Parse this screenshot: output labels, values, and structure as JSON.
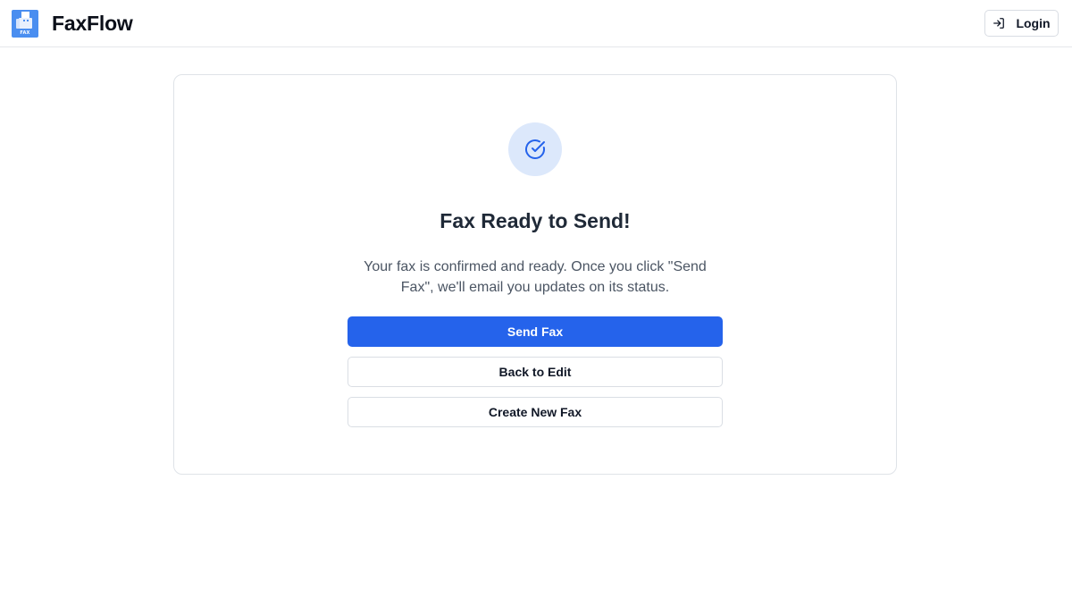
{
  "header": {
    "logo_text": "FAX",
    "app_name": "FaxFlow",
    "login_label": "Login",
    "login_icon": "login-arrow-icon"
  },
  "confirmation": {
    "status_icon": "check-circle-icon",
    "title": "Fax Ready to Send!",
    "message": "Your fax is confirmed and ready. Once you click \"Send Fax\", we'll email you updates on its status.",
    "send_label": "Send Fax",
    "back_label": "Back to Edit",
    "new_label": "Create New Fax"
  },
  "colors": {
    "primary": "#2563eb",
    "logo": "#4a8ef0",
    "status_circle": "#dce8fb"
  }
}
